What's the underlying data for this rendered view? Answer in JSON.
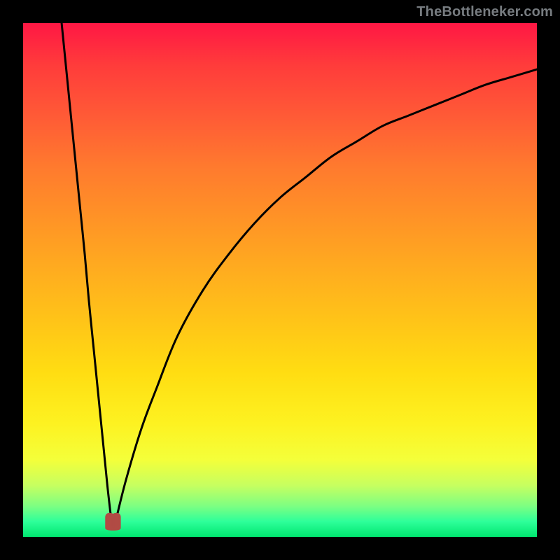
{
  "watermark": {
    "text": "TheBottleneker.com"
  },
  "colors": {
    "frame": "#000000",
    "curve": "#000000",
    "marker_fill": "#b14b44",
    "marker_stroke": "#b14b44",
    "gradient_top": "#ff1744",
    "gradient_bottom": "#00e66f"
  },
  "chart_data": {
    "type": "line",
    "title": "",
    "xlabel": "",
    "ylabel": "",
    "xlim": [
      0,
      100
    ],
    "ylim": [
      0,
      100
    ],
    "legend": null,
    "annotations": [],
    "notes": "Axes unlabeled; values are read off as percentages of the plotting area. Left branch descends steeply from the top-left toward a cusp near x≈17, y≈3. Right branch rises from the cusp with decreasing slope toward the upper-right, ending near y≈91 at x=100.",
    "series": [
      {
        "name": "left_branch",
        "x": [
          7.5,
          8.4,
          9.3,
          10.2,
          11.1,
          12.0,
          12.8,
          13.7,
          14.6,
          15.5,
          16.4,
          17.2
        ],
        "y": [
          100,
          91,
          82,
          73,
          64,
          55,
          46,
          37,
          28,
          19,
          10,
          3
        ]
      },
      {
        "name": "right_branch",
        "x": [
          18.0,
          20,
          23,
          26,
          30,
          35,
          40,
          45,
          50,
          55,
          60,
          65,
          70,
          75,
          80,
          85,
          90,
          95,
          100
        ],
        "y": [
          3,
          11,
          21,
          29,
          39,
          48,
          55,
          61,
          66,
          70,
          74,
          77,
          80,
          82,
          84,
          86,
          88,
          89.5,
          91
        ]
      }
    ],
    "marker": {
      "shape": "cusp_lobes",
      "cx": 17.5,
      "cy": 3.0,
      "approx_width_pct": 3.0,
      "approx_height_pct": 3.2
    }
  }
}
